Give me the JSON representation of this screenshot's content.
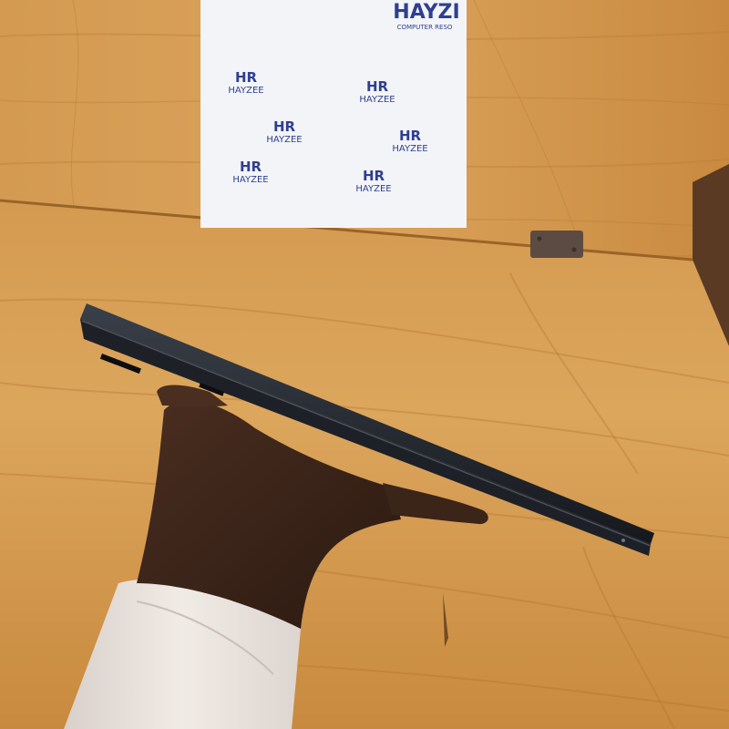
{
  "sign": {
    "brand": "HAYZI",
    "tagline": "COMPUTER RESO",
    "logo_word": "HAYZEE",
    "logo_mark": "HR"
  },
  "colors": {
    "wood_light": "#e0a75a",
    "wood_mid": "#cc8c3e",
    "wood_dark": "#a86a28",
    "sign_bg": "#f3f4f7",
    "brand_blue": "#2f3f8f",
    "laptop": "#23272e",
    "skin": "#3b2418",
    "sleeve": "#ebe4df"
  }
}
